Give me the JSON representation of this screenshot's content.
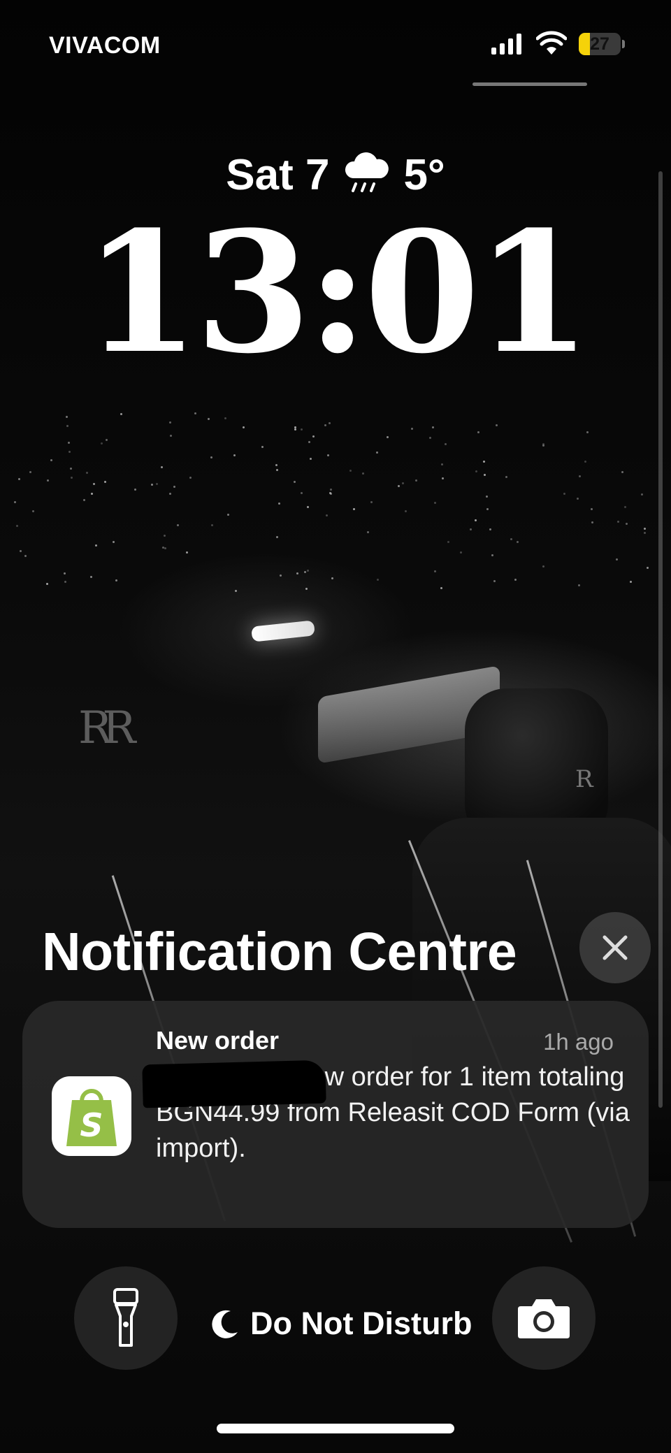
{
  "status_bar": {
    "carrier": "VIVACOM",
    "battery_level": "27",
    "battery_fraction": 0.27,
    "battery_color": "#f5d20a",
    "icons": [
      "cellular-signal-icon",
      "wifi-icon",
      "battery-icon"
    ]
  },
  "lock_screen": {
    "date": "Sat 7",
    "weather_icon": "rain-cloud-icon",
    "temperature": "5°",
    "time": "13:01"
  },
  "notification_centre": {
    "title": "Notification Centre",
    "close_icon": "close-icon"
  },
  "notification": {
    "app_icon": "shopify-bag-icon",
    "app_color": "#95bf47",
    "title": "New order",
    "time": "1h ago",
    "body": "You have a new order for 1 item totaling BGN44.99 from Releasit COD Form (via import)."
  },
  "bottom_controls": {
    "flashlight_icon": "flashlight-icon",
    "focus_icon": "moon-icon",
    "focus_label": "Do Not Disturb",
    "camera_icon": "camera-icon"
  }
}
